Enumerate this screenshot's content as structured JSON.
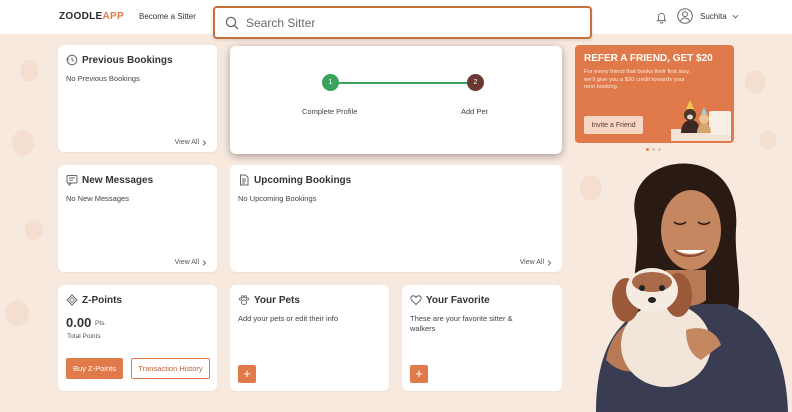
{
  "header": {
    "logo_main": "ZOODLE",
    "logo_accent": "APP",
    "become_sitter": "Become a Sitter",
    "search_placeholder": "Search Sitter",
    "user_name": "Suchita"
  },
  "progress": {
    "steps": [
      {
        "number": "1",
        "label": "Complete Profile"
      },
      {
        "number": "2",
        "label": "Add Pet"
      }
    ]
  },
  "previous_bookings": {
    "title": "Previous Bookings",
    "text": "No Previous Bookings",
    "link": "View All"
  },
  "new_messages": {
    "title": "New Messages",
    "text": "No New Messages",
    "link": "View All"
  },
  "upcoming_bookings": {
    "title": "Upcoming Bookings",
    "text": "No Upcoming Bookings",
    "link": "View All"
  },
  "zpoints": {
    "title": "Z-Points",
    "value": "0.00",
    "unit": "Pts.",
    "caption": "Total Points",
    "buy_label": "Buy Z-Points",
    "history_label": "Transaction History"
  },
  "your_pets": {
    "title": "Your Pets",
    "text": "Add your pets or edit their info",
    "add": "+"
  },
  "your_favorite": {
    "title": "Your Favorite",
    "text": "These are your favorite sitter & walkers",
    "add": "+"
  },
  "refer": {
    "title": "REFER A FRIEND, GET $20",
    "body": "For every friend that books their first stay, we'll give you a $20 credit towards your next booking.",
    "button": "Invite a Friend"
  },
  "colors": {
    "accent": "#e07a4a",
    "step_done": "#3aa35e",
    "step_pending": "#6a3a32",
    "background": "#f8e9df"
  },
  "icons": [
    "search-icon",
    "bell-icon",
    "user-icon",
    "chevron-down-icon",
    "history-icon",
    "message-icon",
    "document-icon",
    "diamond-icon",
    "paw-icon",
    "heart-icon"
  ]
}
